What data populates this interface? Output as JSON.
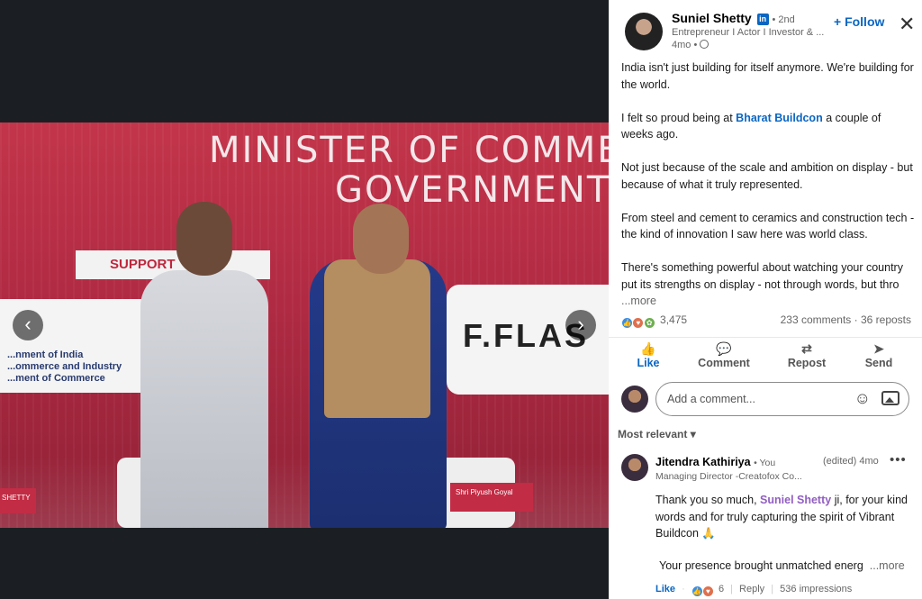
{
  "photo": {
    "banner_line1": "MINISTER OF COMME",
    "banner_line2": "GOVERNMENT",
    "supported": "SUPPORT",
    "govt_text": "...nment of India\n...ommerce and Industry\n...ment of Commerce",
    "flash": "F.FLAS",
    "nameplate": "Shri Piyush Goyal",
    "nameplate2": "SHETTY",
    "prev_label": "‹",
    "next_label": "›"
  },
  "post": {
    "author": "Suniel Shetty",
    "degree": "• 2nd",
    "headline": "Entrepreneur I Actor I Investor & ...",
    "time": "4mo •",
    "follow_label": "+ Follow",
    "close_label": "✕",
    "p1": "India isn't just building for itself anymore. We're building for the world.",
    "p2_pre": "I felt so proud being at ",
    "p2_link": "Bharat Buildcon",
    "p2_post": " a couple of weeks ago.",
    "p3": "Not just because of the scale and ambition on display - but because of what it truly represented.",
    "p4": "From steel and cement to ceramics and construction tech - the kind of innovation I saw here was world class.",
    "p5": "There's something powerful about watching your country put its strengths on display - not through words, but thro",
    "more": "...more"
  },
  "social": {
    "reactions": "3,475",
    "comments_reposts": "233 comments · 36 reposts"
  },
  "actions": {
    "like": "Like",
    "comment": "Comment",
    "repost": "Repost",
    "send": "Send"
  },
  "composer": {
    "placeholder": "Add a comment..."
  },
  "sort": {
    "label": "Most relevant ▾"
  },
  "comment": {
    "author": "Jitendra Kathiriya",
    "you": "• You",
    "meta": "Managing Director -Creatofox Co...",
    "time": "(edited) 4mo",
    "dots": "•••",
    "pre": "Thank you so much, ",
    "mention": "Suniel Shetty",
    "post": " ji, for your kind words and for truly capturing the spirit of Vibrant Buildcon 🙏",
    "line2": "Your presence brought unmatched energ",
    "more": "...more",
    "like": "Like",
    "reaction_count": "6",
    "reply": "Reply",
    "impressions": "536 impressions"
  },
  "colors": {
    "accent": "#0a66c2",
    "mention": "#915ec2",
    "backdrop": "#1b1f23"
  }
}
